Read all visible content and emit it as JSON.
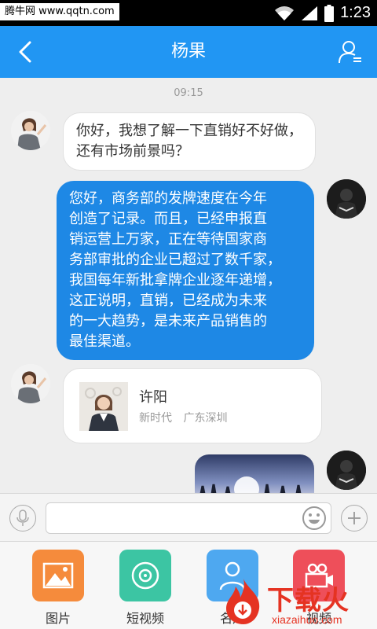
{
  "status_bar": {
    "watermark": "腾牛网 www.qqtn.com",
    "time": "1:23"
  },
  "header": {
    "title": "杨果"
  },
  "chat": {
    "timestamp": "09:15",
    "messages": [
      {
        "side": "left",
        "line1": "你好，我想了解一下直销好不好做，",
        "line2": "还有市场前景吗？"
      },
      {
        "side": "right",
        "lines": [
          "您好，商务部的发牌速度在今年",
          "创造了记录。而且，已经申报直",
          "销运营上万家，正在等待国家商",
          "务部审批的企业已超过了数千家，",
          "我国每年新批拿牌企业逐年递增，",
          "这正说明，直销，已经成为未来",
          "的一大趋势，是未来产品销售的",
          "最佳渠道。"
        ]
      }
    ],
    "card": {
      "name": "许阳",
      "company": "新时代",
      "location": "广东深圳"
    }
  },
  "panel": {
    "items": [
      {
        "label": "图片",
        "color": "#f58b3c",
        "icon": "image-icon"
      },
      {
        "label": "短视频",
        "color": "#3cc5a3",
        "icon": "short-video-icon"
      },
      {
        "label": "名片",
        "color": "#4ea8f0",
        "icon": "contact-card-icon"
      },
      {
        "label": "视频",
        "color": "#ee4f5a",
        "icon": "video-call-icon"
      }
    ]
  },
  "watermark_bottom": {
    "brand": "下载火",
    "domain": "xiazaihuo.com"
  },
  "colors": {
    "header": "#2196f3",
    "bubble_right": "#1e88e5"
  }
}
